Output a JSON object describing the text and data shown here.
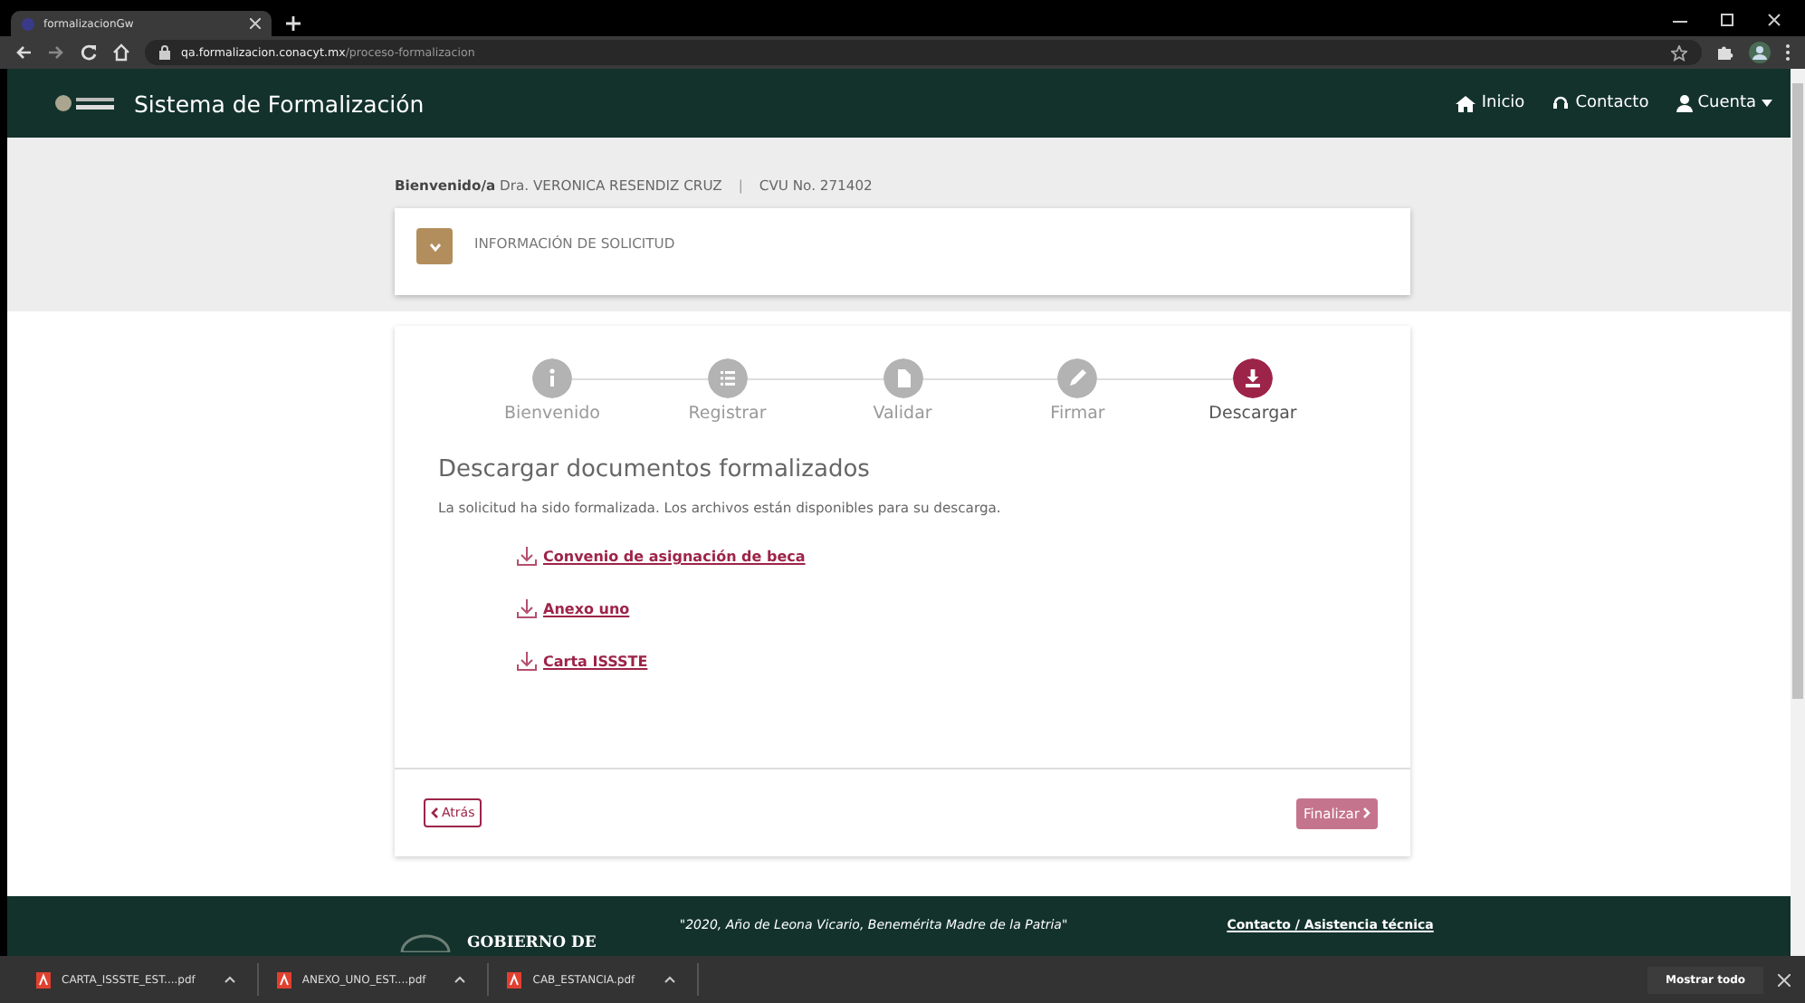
{
  "browser": {
    "tab_title": "formalizacionGw",
    "url_host": "qa.formalizacion.conacyt.mx",
    "url_path": "/proceso-formalizacion"
  },
  "navbar": {
    "title": "Sistema de Formalización",
    "links": [
      {
        "label": "Inicio"
      },
      {
        "label": "Contacto"
      },
      {
        "label": "Cuenta"
      }
    ]
  },
  "welcome": {
    "greeting": "Bienvenido/a",
    "name": "Dra. VERONICA RESENDIZ CRUZ",
    "separator": "|",
    "cvu": "CVU No. 271402"
  },
  "info_panel": {
    "title": "INFORMACIÓN DE SOLICITUD",
    "expanded": false
  },
  "steps": [
    {
      "label": "Bienvenido",
      "selected": false
    },
    {
      "label": "Registrar",
      "selected": false
    },
    {
      "label": "Validar",
      "selected": false
    },
    {
      "label": "Firmar",
      "selected": false
    },
    {
      "label": "Descargar",
      "selected": true
    }
  ],
  "content": {
    "heading": "Descargar documentos formalizados",
    "description": "La solicitud ha sido formalizada. Los archivos están disponibles para su descarga.",
    "documents": [
      {
        "label": "Convenio de asignación de beca"
      },
      {
        "label": "Anexo uno"
      },
      {
        "label": "Carta ISSSTE"
      }
    ]
  },
  "buttons": {
    "back": "Atrás",
    "finish": "Finalizar"
  },
  "footer": {
    "logo_text": "GOBIERNO DE",
    "motto": "\"2020, Año de Leona Vicario, Benemérita Madre de la Patria\"",
    "contact": "Contacto / Asistencia técnica"
  },
  "downloads": {
    "files": [
      {
        "name": "CARTA_ISSSTE_EST....pdf"
      },
      {
        "name": "ANEXO_UNO_EST....pdf"
      },
      {
        "name": "CAB_ESTANCIA.pdf"
      }
    ],
    "show_all": "Mostrar todo"
  }
}
